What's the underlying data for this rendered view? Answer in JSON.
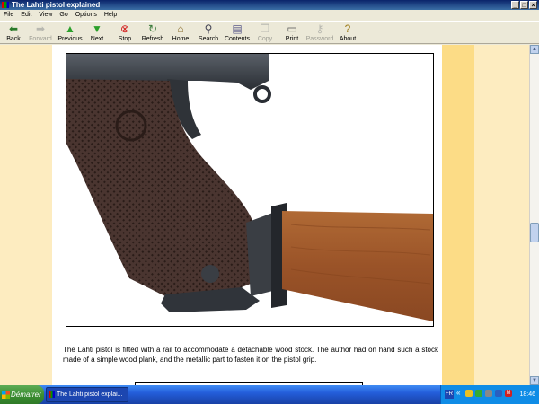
{
  "window": {
    "title": "The Lahti pistol explained",
    "buttons": {
      "minimize": "_",
      "maximize": "□",
      "close": "×"
    }
  },
  "menu": [
    "File",
    "Edit",
    "View",
    "Go",
    "Options",
    "Help"
  ],
  "toolbar": {
    "back": "Back",
    "forward": "Forward",
    "previous": "Previous",
    "next": "Next",
    "stop": "Stop",
    "refresh": "Refresh",
    "home": "Home",
    "search": "Search",
    "contents": "Contents",
    "copy": "Copy",
    "print": "Print",
    "password": "Password",
    "about": "About"
  },
  "content": {
    "photo_alt_icon": "pistol-with-wooden-stock-photo",
    "caption": "The Lahti pistol is fitted with a rail to accommodate a detachable wood stock. The author had on hand such a stock made of a simple wood plank, and the metallic part to fasten it on the pistol grip."
  },
  "taskbar": {
    "start": "Démarrer",
    "task": "The Lahti pistol explai...",
    "tray_lang": "FR",
    "chevron": "«",
    "tray_letter": "M",
    "clock": "18:46"
  },
  "colors": {
    "page_background": "#fdecc0",
    "page_stripe": "#fcdc86",
    "content_background": "#ffffff",
    "taskbar": "#245edb",
    "start_button": "#3c8f33"
  }
}
